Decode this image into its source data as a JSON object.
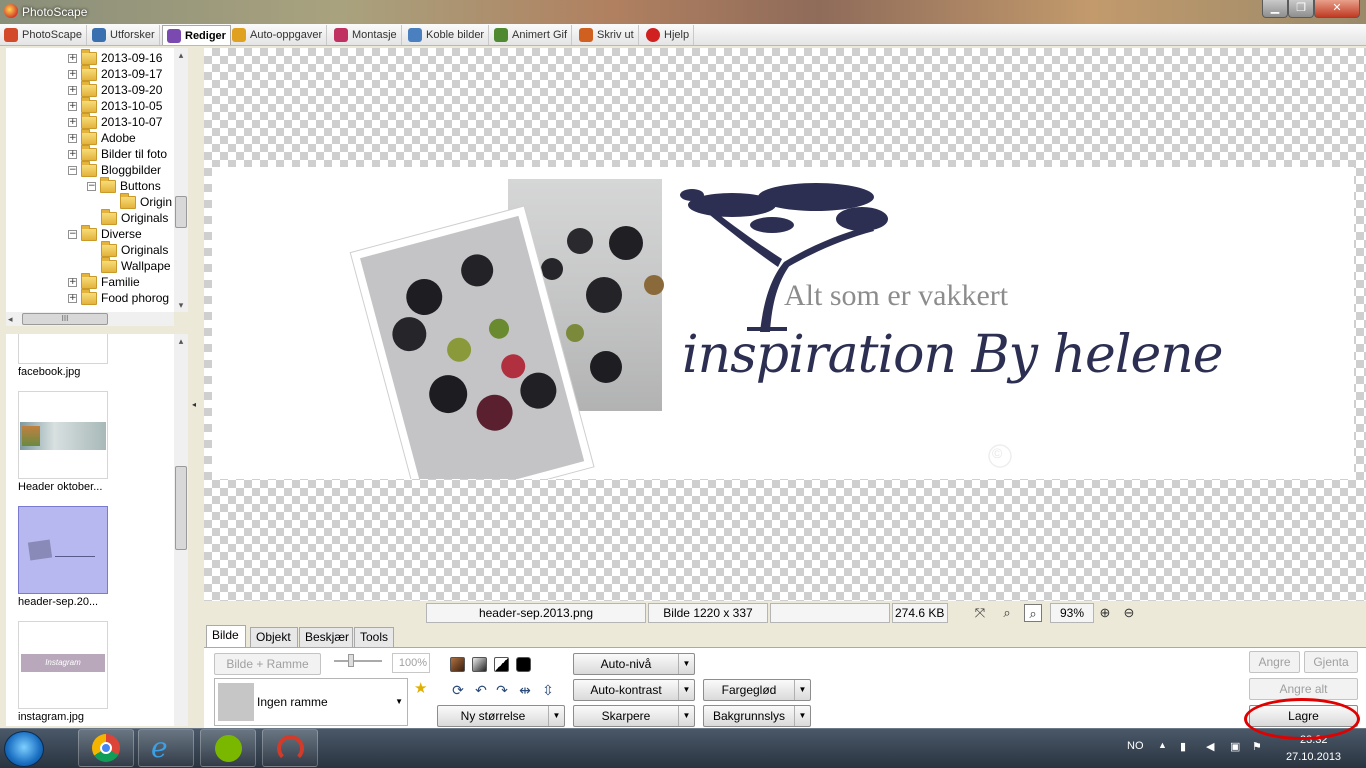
{
  "window": {
    "title": "PhotoScape",
    "controls": {
      "minimize": "▁",
      "maximize": "❐",
      "close": "✕"
    }
  },
  "tabs": [
    {
      "label": "PhotoScape",
      "icon": "photoscape-icon",
      "color": "#d24a2a"
    },
    {
      "label": "Utforsker",
      "icon": "explorer-icon",
      "color": "#3a6fb0"
    },
    {
      "label": "Rediger",
      "icon": "editor-icon",
      "color": "#7a4ab0",
      "active": true
    },
    {
      "label": "Auto-oppgaver",
      "icon": "batch-icon",
      "color": "#e0a020"
    },
    {
      "label": "Montasje",
      "icon": "page-icon",
      "color": "#c03060"
    },
    {
      "label": "Koble bilder",
      "icon": "combine-icon",
      "color": "#4a80c0"
    },
    {
      "label": "Animert Gif",
      "icon": "gif-icon",
      "color": "#508a30"
    },
    {
      "label": "Skriv ut",
      "icon": "print-icon",
      "color": "#d06020"
    },
    {
      "label": "Hjelp",
      "icon": "help-icon",
      "color": "#d02020"
    }
  ],
  "tree": [
    {
      "label": "2013-09-16",
      "expander": "+"
    },
    {
      "label": "2013-09-17",
      "expander": "+"
    },
    {
      "label": "2013-09-20",
      "expander": "+"
    },
    {
      "label": "2013-10-05",
      "expander": "+"
    },
    {
      "label": "2013-10-07",
      "expander": "+"
    },
    {
      "label": "Adobe",
      "expander": "+"
    },
    {
      "label": "Bilder til foto",
      "expander": "+"
    },
    {
      "label": "Bloggbilder",
      "expander": "−"
    },
    {
      "label": "Buttons",
      "expander": "−"
    },
    {
      "label": "Origin",
      "expander": ""
    },
    {
      "label": "Originals",
      "expander": ""
    },
    {
      "label": "Diverse",
      "expander": "−"
    },
    {
      "label": "Originals",
      "expander": ""
    },
    {
      "label": "Wallpape",
      "expander": ""
    },
    {
      "label": "Familie",
      "expander": "+"
    },
    {
      "label": "Food phorog",
      "expander": "+"
    }
  ],
  "tree_scroll": {
    "left_arrow": "◂",
    "grip": "III",
    "up_arrow": "▴",
    "down_arrow": "▾"
  },
  "thumbnails": [
    {
      "name": "facebook.jpg"
    },
    {
      "name": "Header oktober..."
    },
    {
      "name": "header-sep.20..."
    },
    {
      "name": "instagram.jpg",
      "preview_text": "Instagram"
    }
  ],
  "splitter_arrow": "◂",
  "image": {
    "tagline": "Alt som er vakkert",
    "script_title": "inspiration By helene",
    "watermark": "©",
    "colors": {
      "ink": "#2c2f52",
      "gray": "#8c8c8c"
    }
  },
  "status": {
    "filename": "header-sep.2013.png",
    "dimensions": "Bilde 1220 x 337",
    "filesize": "274.6 KB",
    "zoom": "93%"
  },
  "panel_tabs": [
    "Bilde",
    "Objekt",
    "Beskjær",
    "Tools"
  ],
  "panel": {
    "frame_button": "Bilde + Ramme",
    "frame_percent": "100%",
    "frame_select": "Ingen ramme",
    "resize": "Ny størrelse",
    "auto_level": "Auto-nivå",
    "auto_contrast": "Auto-kontrast",
    "sharpen": "Skarpere",
    "glow": "Fargeglød",
    "backlight": "Bakgrunnslys",
    "undo": "Angre",
    "redo": "Gjenta",
    "undo_all": "Angre alt",
    "save": "Lagre"
  },
  "taskbar": {
    "language": "NO",
    "time": "23:32",
    "date": "27.10.2013"
  }
}
